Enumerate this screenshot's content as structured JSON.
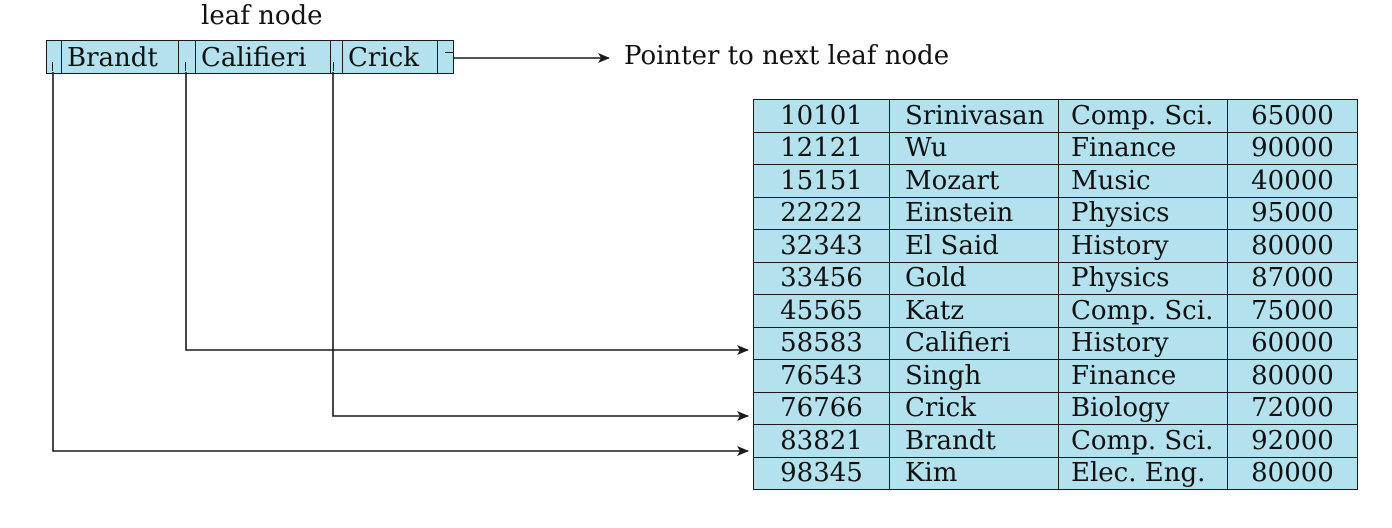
{
  "leaf_node": {
    "title": "leaf node",
    "keys": [
      "Brandt",
      "Califieri",
      "Crick"
    ],
    "next_pointer_label": "Pointer to next leaf node"
  },
  "records": [
    [
      "10101",
      "Srinivasan",
      "Comp. Sci.",
      "65000"
    ],
    [
      "12121",
      "Wu",
      "Finance",
      "90000"
    ],
    [
      "15151",
      "Mozart",
      "Music",
      "40000"
    ],
    [
      "22222",
      "Einstein",
      "Physics",
      "95000"
    ],
    [
      "32343",
      "El Said",
      "History",
      "80000"
    ],
    [
      "33456",
      "Gold",
      "Physics",
      "87000"
    ],
    [
      "45565",
      "Katz",
      "Comp. Sci.",
      "75000"
    ],
    [
      "58583",
      "Califieri",
      "History",
      "60000"
    ],
    [
      "76543",
      "Singh",
      "Finance",
      "80000"
    ],
    [
      "76766",
      "Crick",
      "Biology",
      "72000"
    ],
    [
      "83821",
      "Brandt",
      "Comp. Sci.",
      "92000"
    ],
    [
      "98345",
      "Kim",
      "Elec. Eng.",
      "80000"
    ]
  ],
  "colors": {
    "cell_fill": "#b3e2ee",
    "stroke": "#1a1a1a"
  }
}
